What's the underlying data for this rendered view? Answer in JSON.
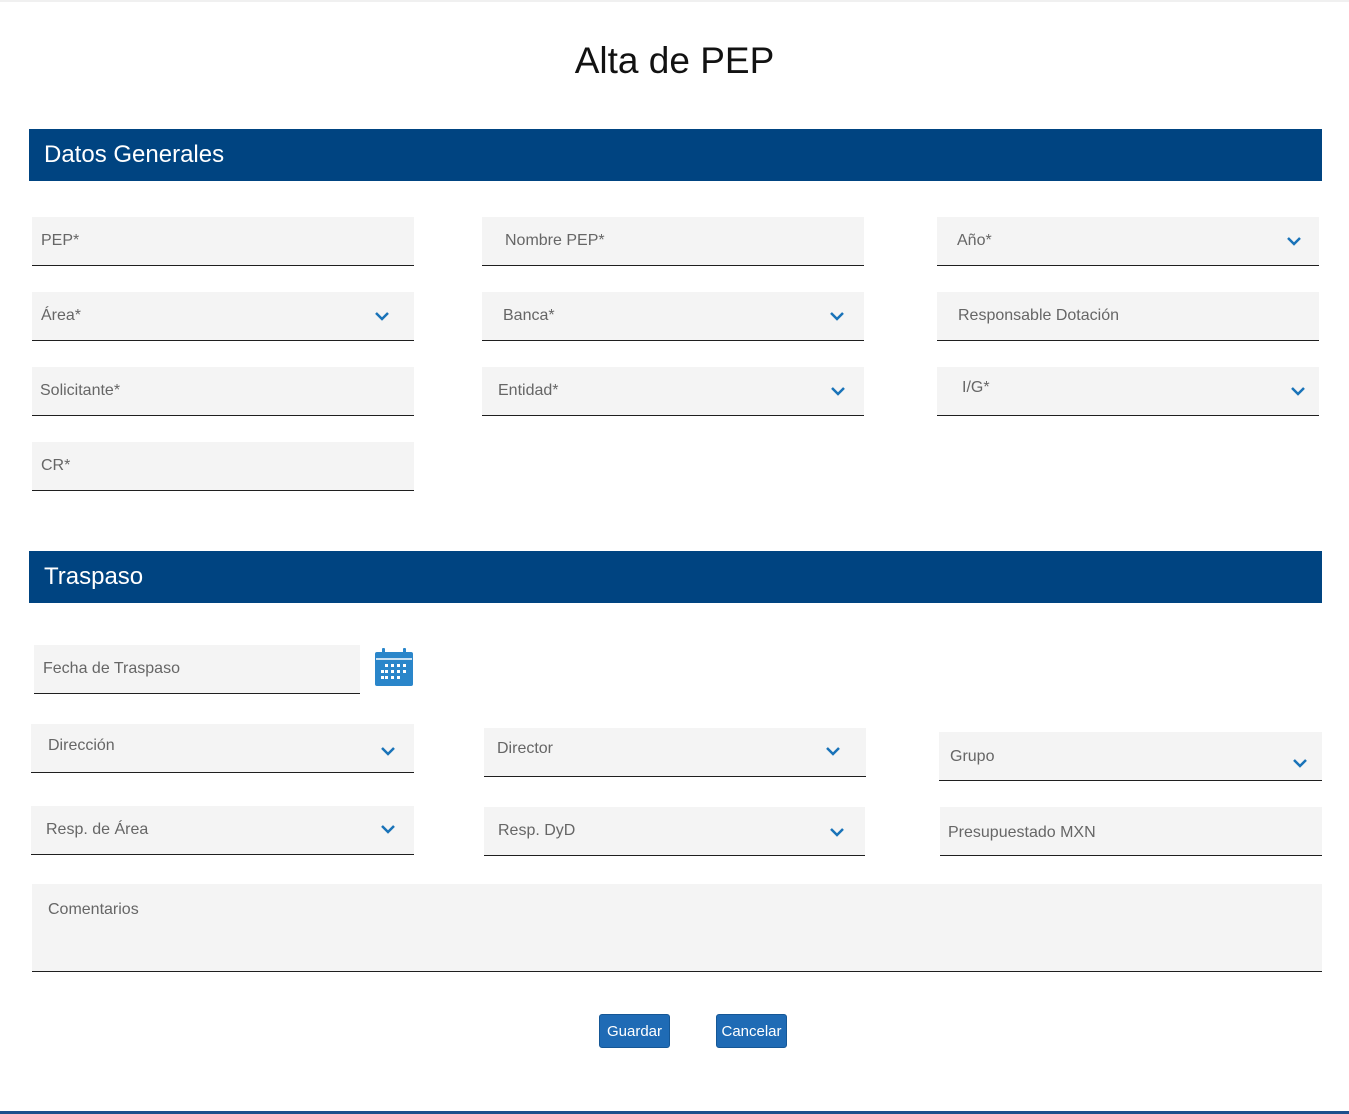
{
  "title": "Alta de PEP",
  "sections": {
    "general": "Datos Generales",
    "transfer": "Traspaso"
  },
  "fields": {
    "pep": "PEP*",
    "nombre_pep": "Nombre PEP*",
    "anio": "Año*",
    "area": "Área*",
    "banca": "Banca*",
    "responsable_dotacion": "Responsable Dotación",
    "solicitante": "Solicitante*",
    "entidad": "Entidad*",
    "ig": "I/G*",
    "cr": "CR*",
    "fecha_traspaso": "Fecha de Traspaso",
    "direccion": "Dirección",
    "director": "Director",
    "grupo": "Grupo",
    "resp_area": "Resp. de Área",
    "resp_dyd": "Resp. DyD",
    "presupuestado": "Presupuestado MXN",
    "comentarios": "Comentarios"
  },
  "buttons": {
    "save": "Guardar",
    "cancel": "Cancelar"
  },
  "colors": {
    "header_bg": "#004481",
    "button_bg": "#1f6bb5",
    "chevron": "#1973b8",
    "calendar": "#2a86ca",
    "field_bg": "#f4f4f4"
  },
  "icons": {
    "dropdown": "chevron-down-icon",
    "date_picker": "calendar-icon"
  }
}
